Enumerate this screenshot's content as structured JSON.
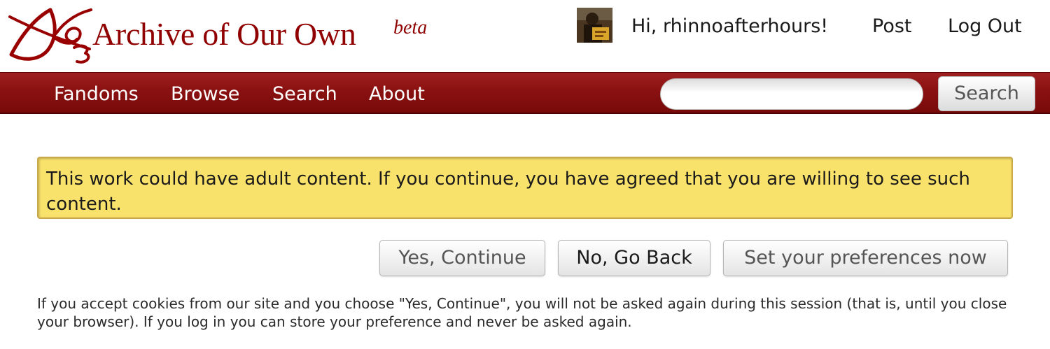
{
  "header": {
    "logo_icon": "ao3-logo-icon",
    "site_title": "Archive of Our Own",
    "beta_label": "beta",
    "avatar_icon": "user-avatar",
    "greeting": "Hi, rhinnoafterhours!",
    "post_link": "Post",
    "logout_link": "Log Out"
  },
  "nav": {
    "items": [
      "Fandoms",
      "Browse",
      "Search",
      "About"
    ],
    "search_placeholder": "",
    "search_button": "Search"
  },
  "notice": {
    "text": "This work could have adult content. If you continue, you have agreed that you are willing to see such content."
  },
  "actions": {
    "yes": "Yes, Continue",
    "no": "No, Go Back",
    "prefs": "Set your preferences now"
  },
  "cookie_note": "If you accept cookies from our site and you choose \"Yes, Continue\", you will not be asked again during this session (that is, until you close your browser). If you log in you can store your preference and never be asked again.",
  "colors": {
    "brand": "#900000",
    "nav_background": "#8a1111",
    "notice_background": "#f9e26b"
  }
}
